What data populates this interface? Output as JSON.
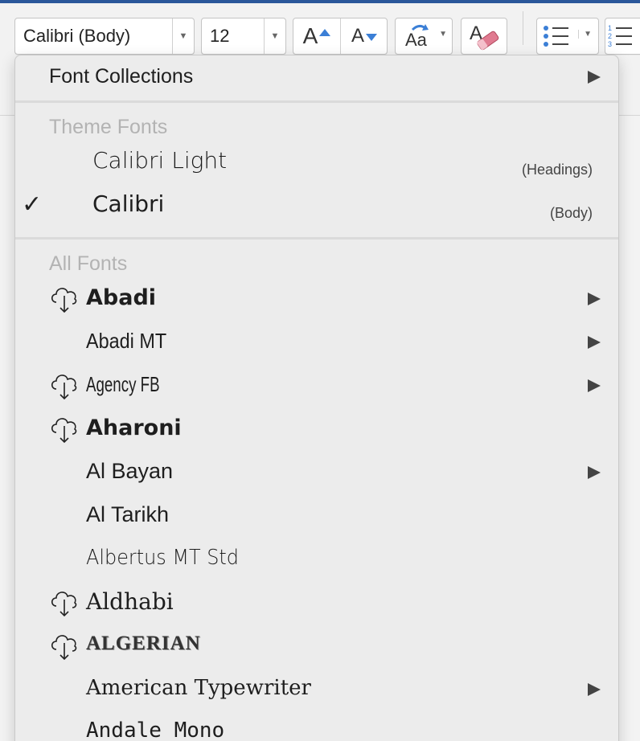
{
  "toolbar": {
    "font_name": "Calibri (Body)",
    "font_size": "12",
    "grow_font_icon": "increase-font-size-icon",
    "shrink_font_icon": "decrease-font-size-icon",
    "change_case_icon": "change-case-icon",
    "clear_format_icon": "eraser-icon",
    "bullets_icon": "bullet-list-icon",
    "numbering_icon": "numbered-list-icon",
    "grow_glyph": "A",
    "shrink_glyph": "A",
    "case_glyph": "Aa"
  },
  "menu": {
    "font_collections": "Font Collections",
    "theme_fonts_label": "Theme Fonts",
    "theme_fonts": [
      {
        "name": "Calibri Light",
        "hint": "(Headings)",
        "checked": false
      },
      {
        "name": "Calibri",
        "hint": "(Body)",
        "checked": true
      }
    ],
    "all_fonts_label": "All Fonts",
    "all_fonts": [
      {
        "name": "Abadi",
        "cloud": true,
        "submenu": true
      },
      {
        "name": "Abadi MT",
        "cloud": false,
        "submenu": true
      },
      {
        "name": "Agency FB",
        "cloud": true,
        "submenu": true
      },
      {
        "name": "Aharoni",
        "cloud": true,
        "submenu": false
      },
      {
        "name": "Al Bayan",
        "cloud": false,
        "submenu": true
      },
      {
        "name": "Al Tarikh",
        "cloud": false,
        "submenu": false
      },
      {
        "name": "Albertus MT Std",
        "cloud": false,
        "submenu": false
      },
      {
        "name": "Aldhabi",
        "cloud": true,
        "submenu": false
      },
      {
        "name": "ALGERIAN",
        "cloud": true,
        "submenu": false
      },
      {
        "name": "American Typewriter",
        "cloud": false,
        "submenu": true
      },
      {
        "name": "Andale Mono",
        "cloud": false,
        "submenu": false
      }
    ]
  },
  "colors": {
    "accent": "#2b579a",
    "icon_blue": "#3b7fd6",
    "eraser_pink": "#e07a90",
    "section_gray": "#b3b3b3"
  }
}
